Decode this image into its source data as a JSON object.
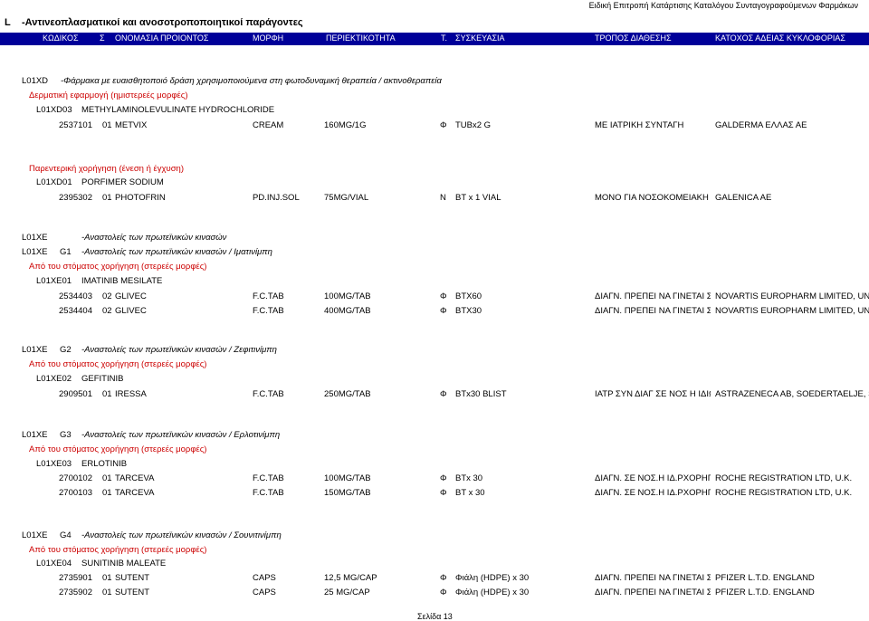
{
  "header": {
    "top_note": "Ειδική Επιτροπή Κατάρτισης Καταλόγου Συνταγογραφούμενων Φαρμάκων",
    "code_l": "L",
    "title": "-Αντινεοπλασματικοί και ανοσοτροποποιητικοί παράγοντες",
    "columns": [
      "ΚΩΔΙΚΟΣ",
      "Σ",
      "ΟΝΟΜΑΣΙΑ ΠΡΟΙΟΝΤΟΣ",
      "ΜΟΡΦΗ",
      "ΠΕΡΙΕΚΤΙΚΟΤΗΤΑ",
      "Τ.",
      "ΣΥΣΚΕΥΑΣΙΑ",
      "ΤΡΟΠΟΣ ΔΙΑΘΕΣΗΣ",
      "ΚΑΤΟΧΟΣ ΑΔΕΙΑΣ ΚΥΚΛΟΦΟΡΙΑΣ"
    ]
  },
  "section1": {
    "code": "L01XD",
    "title": "-Φάρμακα με ευαισθητοποιό δράση χρησιμοποιούμενα στη φωτοδυναμική θεραπεία / ακτινοθεραπεία",
    "route1": "Δερματική εφαρμογή (ημιστερεές μορφές)",
    "sub1_code": "L01XD03",
    "sub1_name": "METHYLAMINOLEVULINATE HYDROCHLORIDE",
    "row1": [
      "2537101",
      "01",
      "METVIX",
      "CREAM",
      "160MG/1G",
      "Φ",
      "TUBx2 G",
      "ΜΕ  ΙΑΤΡΙΚΗ ΣΥΝΤΑΓΗ",
      "GALDERMA ΕΛΛΑΣ ΑΕ"
    ],
    "route2": "Παρεντερική χορήγηση (ένεση ή έγχυση)",
    "sub2_code": "L01XD01",
    "sub2_name": "PORFIMER SODIUM",
    "row2": [
      "2395302",
      "01",
      "PHOTOFRIN",
      "PD.INJ.SOL",
      "75MG/VIAL",
      "Ν",
      "BT x 1 VIAL",
      "ΜΟΝΟ ΓΙΑ ΝΟΣΟΚΟΜΕΙΑΚΗ",
      "GALENICA AE"
    ]
  },
  "section2": {
    "code": "L01XE",
    "title": "-Αναστολείς των πρωτεϊνικών κινασών",
    "g1_code": "L01XE",
    "g1_g": "G1",
    "g1_title": "-Αναστολείς των πρωτεϊνικών κινασών / Ιματινίμπη",
    "g1_route": "Από του στόματος χορήγηση (στερεές μορφές)",
    "g1_sub_code": "L01XE01",
    "g1_sub_name": "IMATINIB MESILATE",
    "g1_rows": [
      [
        "2534403",
        "02",
        "GLIVEC",
        "F.C.TAB",
        "100MG/TAB",
        "Φ",
        "BTX60",
        "ΔΙΑΓΝ. ΠΡΕΠΕΙ ΝΑ ΓΙΝΕΤΑΙ ΣΤΟ",
        "NOVARTIS EUROPHARM LIMITED, UNITED KINGDOM"
      ],
      [
        "2534404",
        "02",
        "GLIVEC",
        "F.C.TAB",
        "400MG/TAB",
        "Φ",
        "BTX30",
        "ΔΙΑΓΝ. ΠΡΕΠΕΙ ΝΑ ΓΙΝΕΤΑΙ ΣΤΟ",
        "NOVARTIS EUROPHARM LIMITED, UNITED KINGDOM"
      ]
    ],
    "g2_code": "L01XE",
    "g2_g": "G2",
    "g2_title": "-Αναστολείς των πρωτεϊνικών κινασών / Ζεφιτινίμπη",
    "g2_route": "Από του στόματος χορήγηση (στερεές μορφές)",
    "g2_sub_code": "L01XE02",
    "g2_sub_name": "GEFITINIB",
    "g2_rows": [
      [
        "2909501",
        "01",
        "IRESSA",
        "F.C.TAB",
        "250MG/TAB",
        "Φ",
        "BTx30 BLIST",
        "ΙΑΤΡ ΣΥΝ ΔΙΑΓ ΣΕ ΝΟΣ Η ΙΔΙΩΤ",
        "ASTRAZENECA AB, SOEDERTAELJE, SWEDEN"
      ]
    ],
    "g3_code": "L01XE",
    "g3_g": "G3",
    "g3_title": "-Αναστολείς των πρωτεϊνικών κινασών / Ερλοτινίμπη",
    "g3_route": "Από του στόματος χορήγηση (στερεές μορφές)",
    "g3_sub_code": "L01XE03",
    "g3_sub_name": "ERLOTINIB",
    "g3_rows": [
      [
        "2700102",
        "01",
        "TARCEVA",
        "F.C.TAB",
        "100MG/TAB",
        "Φ",
        "BTx 30",
        "ΔΙΑΓΝ. ΣΕ ΝΟΣ.Η ΙΔ.ΡΧΟΡΗΓ",
        "ROCHE REGISTRATION LTD, U.K."
      ],
      [
        "2700103",
        "01",
        "TARCEVA",
        "F.C.TAB",
        "150MG/TAB",
        "Φ",
        "BT x 30",
        "ΔΙΑΓΝ. ΣΕ ΝΟΣ.Η ΙΔ.ΡΧΟΡΗΓ",
        "ROCHE REGISTRATION LTD, U.K."
      ]
    ],
    "g4_code": "L01XE",
    "g4_g": "G4",
    "g4_title": "-Αναστολείς των πρωτεϊνικών κινασών / Σουνιτινίμπη",
    "g4_route": "Από του στόματος χορήγηση (στερεές μορφές)",
    "g4_sub_code": "L01XE04",
    "g4_sub_name": "SUNITINIB MALEATE",
    "g4_rows": [
      [
        "2735901",
        "01",
        "SUTENT",
        "CAPS",
        "12,5 MG/CAP",
        "Φ",
        "Φιάλη (HDPE) x 30",
        "ΔΙΑΓΝ. ΠΡΕΠΕΙ ΝΑ ΓΙΝΕΤΑΙ ΣΤΟ",
        "PFIZER L.T.D. ENGLAND"
      ],
      [
        "2735902",
        "01",
        "SUTENT",
        "CAPS",
        "25 MG/CAP",
        "Φ",
        "Φιάλη (HDPE) x 30",
        "ΔΙΑΓΝ. ΠΡΕΠΕΙ ΝΑ ΓΙΝΕΤΑΙ ΣΤΟ",
        "PFIZER L.T.D. ENGLAND"
      ]
    ]
  },
  "footer": {
    "page": "Σελίδα 13"
  }
}
